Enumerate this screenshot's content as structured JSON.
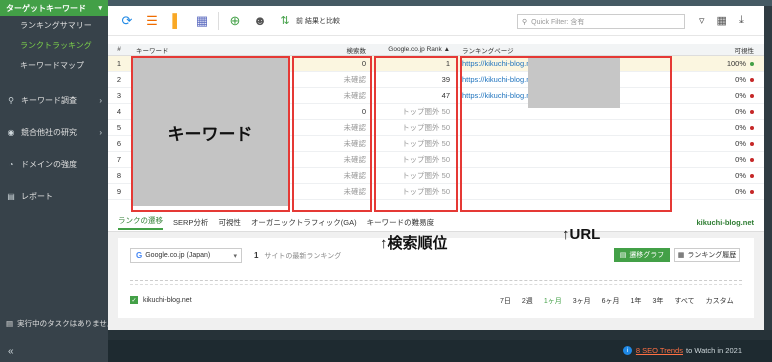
{
  "sidebar": {
    "header": "ターゲットキーワード",
    "subitems": [
      "ランキングサマリー",
      "ランクトラッキング",
      "キーワードマップ"
    ],
    "items": [
      "キーワード調査",
      "競合他社の研究",
      "ドメインの強度",
      "レポート"
    ],
    "task": "実行中のタスクはありません"
  },
  "toolbar": {
    "compare_label": "前 結果と比較",
    "filter_placeholder": "Quick Filter: 含有"
  },
  "table": {
    "headers": {
      "num": "#",
      "keyword": "キーワード",
      "volume": "検索数",
      "rank": "Google.co.jp Rank ▲",
      "page": "ランキングページ",
      "visibility": "可視性"
    },
    "rows": [
      {
        "num": "1",
        "volume": "0",
        "rank": "1",
        "page": "https://kikuchi-blog.net/",
        "vis": "100%",
        "dot": "green"
      },
      {
        "num": "2",
        "volume": "未確認",
        "rank": "39",
        "page": "https://kikuchi-blog.net/",
        "vis": "0%",
        "dot": "red"
      },
      {
        "num": "3",
        "volume": "未確認",
        "rank": "47",
        "page": "https://kikuchi-blog.net/",
        "vis": "0%",
        "dot": "red"
      },
      {
        "num": "4",
        "volume": "0",
        "rank": "トップ圏外 50",
        "page": "",
        "vis": "0%",
        "dot": "red"
      },
      {
        "num": "5",
        "volume": "未確認",
        "rank": "トップ圏外 50",
        "page": "",
        "vis": "0%",
        "dot": "red"
      },
      {
        "num": "6",
        "volume": "未確認",
        "rank": "トップ圏外 50",
        "page": "",
        "vis": "0%",
        "dot": "red"
      },
      {
        "num": "7",
        "volume": "未確認",
        "rank": "トップ圏外 50",
        "page": "",
        "vis": "0%",
        "dot": "red"
      },
      {
        "num": "8",
        "volume": "未確認",
        "rank": "トップ圏外 50",
        "page": "",
        "vis": "0%",
        "dot": "red"
      },
      {
        "num": "9",
        "volume": "未確認",
        "rank": "トップ圏外 50",
        "page": "",
        "vis": "0%",
        "dot": "red"
      }
    ],
    "keyword_overlay": "キーワード"
  },
  "annotations": {
    "rank": "↑検索順位",
    "url": "↑URL"
  },
  "lower": {
    "tabs": [
      "ランクの遷移",
      "SERP分析",
      "可視性",
      "オーガニックトラフィック(GA)",
      "キーワードの難易度"
    ],
    "site": "kikuchi-blog.net",
    "engine": "Google.co.jp (Japan)",
    "recent_count": "1",
    "recent_label": "サイトの最新ランキング",
    "graph_button": "遷移グラフ",
    "history_button": "ランキング履歴",
    "legend_site": "kikuchi-blog.net",
    "periods": [
      "7日",
      "2週",
      "1ヶ月",
      "3ヶ月",
      "6ヶ月",
      "1年",
      "3年",
      "すべて",
      "カスタム"
    ]
  },
  "footer": {
    "trends_link": "8 SEO Trends",
    "trends_rest": "to Watch in 2021"
  },
  "colors": {
    "accent_green": "#43a047",
    "link_blue": "#1e73be",
    "annotation_red": "#e53935"
  }
}
